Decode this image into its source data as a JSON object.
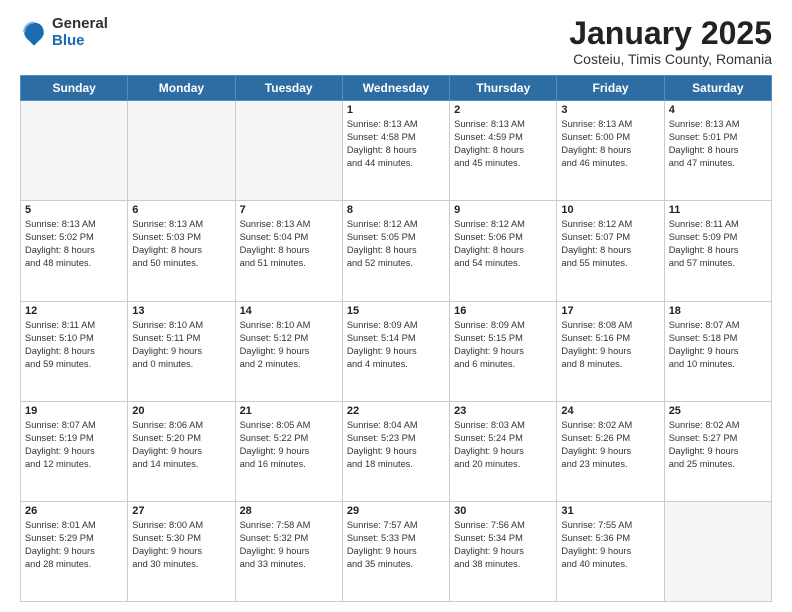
{
  "logo": {
    "general": "General",
    "blue": "Blue"
  },
  "header": {
    "title": "January 2025",
    "subtitle": "Costeiu, Timis County, Romania"
  },
  "weekdays": [
    "Sunday",
    "Monday",
    "Tuesday",
    "Wednesday",
    "Thursday",
    "Friday",
    "Saturday"
  ],
  "weeks": [
    [
      {
        "day": "",
        "info": ""
      },
      {
        "day": "",
        "info": ""
      },
      {
        "day": "",
        "info": ""
      },
      {
        "day": "1",
        "info": "Sunrise: 8:13 AM\nSunset: 4:58 PM\nDaylight: 8 hours\nand 44 minutes."
      },
      {
        "day": "2",
        "info": "Sunrise: 8:13 AM\nSunset: 4:59 PM\nDaylight: 8 hours\nand 45 minutes."
      },
      {
        "day": "3",
        "info": "Sunrise: 8:13 AM\nSunset: 5:00 PM\nDaylight: 8 hours\nand 46 minutes."
      },
      {
        "day": "4",
        "info": "Sunrise: 8:13 AM\nSunset: 5:01 PM\nDaylight: 8 hours\nand 47 minutes."
      }
    ],
    [
      {
        "day": "5",
        "info": "Sunrise: 8:13 AM\nSunset: 5:02 PM\nDaylight: 8 hours\nand 48 minutes."
      },
      {
        "day": "6",
        "info": "Sunrise: 8:13 AM\nSunset: 5:03 PM\nDaylight: 8 hours\nand 50 minutes."
      },
      {
        "day": "7",
        "info": "Sunrise: 8:13 AM\nSunset: 5:04 PM\nDaylight: 8 hours\nand 51 minutes."
      },
      {
        "day": "8",
        "info": "Sunrise: 8:12 AM\nSunset: 5:05 PM\nDaylight: 8 hours\nand 52 minutes."
      },
      {
        "day": "9",
        "info": "Sunrise: 8:12 AM\nSunset: 5:06 PM\nDaylight: 8 hours\nand 54 minutes."
      },
      {
        "day": "10",
        "info": "Sunrise: 8:12 AM\nSunset: 5:07 PM\nDaylight: 8 hours\nand 55 minutes."
      },
      {
        "day": "11",
        "info": "Sunrise: 8:11 AM\nSunset: 5:09 PM\nDaylight: 8 hours\nand 57 minutes."
      }
    ],
    [
      {
        "day": "12",
        "info": "Sunrise: 8:11 AM\nSunset: 5:10 PM\nDaylight: 8 hours\nand 59 minutes."
      },
      {
        "day": "13",
        "info": "Sunrise: 8:10 AM\nSunset: 5:11 PM\nDaylight: 9 hours\nand 0 minutes."
      },
      {
        "day": "14",
        "info": "Sunrise: 8:10 AM\nSunset: 5:12 PM\nDaylight: 9 hours\nand 2 minutes."
      },
      {
        "day": "15",
        "info": "Sunrise: 8:09 AM\nSunset: 5:14 PM\nDaylight: 9 hours\nand 4 minutes."
      },
      {
        "day": "16",
        "info": "Sunrise: 8:09 AM\nSunset: 5:15 PM\nDaylight: 9 hours\nand 6 minutes."
      },
      {
        "day": "17",
        "info": "Sunrise: 8:08 AM\nSunset: 5:16 PM\nDaylight: 9 hours\nand 8 minutes."
      },
      {
        "day": "18",
        "info": "Sunrise: 8:07 AM\nSunset: 5:18 PM\nDaylight: 9 hours\nand 10 minutes."
      }
    ],
    [
      {
        "day": "19",
        "info": "Sunrise: 8:07 AM\nSunset: 5:19 PM\nDaylight: 9 hours\nand 12 minutes."
      },
      {
        "day": "20",
        "info": "Sunrise: 8:06 AM\nSunset: 5:20 PM\nDaylight: 9 hours\nand 14 minutes."
      },
      {
        "day": "21",
        "info": "Sunrise: 8:05 AM\nSunset: 5:22 PM\nDaylight: 9 hours\nand 16 minutes."
      },
      {
        "day": "22",
        "info": "Sunrise: 8:04 AM\nSunset: 5:23 PM\nDaylight: 9 hours\nand 18 minutes."
      },
      {
        "day": "23",
        "info": "Sunrise: 8:03 AM\nSunset: 5:24 PM\nDaylight: 9 hours\nand 20 minutes."
      },
      {
        "day": "24",
        "info": "Sunrise: 8:02 AM\nSunset: 5:26 PM\nDaylight: 9 hours\nand 23 minutes."
      },
      {
        "day": "25",
        "info": "Sunrise: 8:02 AM\nSunset: 5:27 PM\nDaylight: 9 hours\nand 25 minutes."
      }
    ],
    [
      {
        "day": "26",
        "info": "Sunrise: 8:01 AM\nSunset: 5:29 PM\nDaylight: 9 hours\nand 28 minutes."
      },
      {
        "day": "27",
        "info": "Sunrise: 8:00 AM\nSunset: 5:30 PM\nDaylight: 9 hours\nand 30 minutes."
      },
      {
        "day": "28",
        "info": "Sunrise: 7:58 AM\nSunset: 5:32 PM\nDaylight: 9 hours\nand 33 minutes."
      },
      {
        "day": "29",
        "info": "Sunrise: 7:57 AM\nSunset: 5:33 PM\nDaylight: 9 hours\nand 35 minutes."
      },
      {
        "day": "30",
        "info": "Sunrise: 7:56 AM\nSunset: 5:34 PM\nDaylight: 9 hours\nand 38 minutes."
      },
      {
        "day": "31",
        "info": "Sunrise: 7:55 AM\nSunset: 5:36 PM\nDaylight: 9 hours\nand 40 minutes."
      },
      {
        "day": "",
        "info": ""
      }
    ]
  ]
}
